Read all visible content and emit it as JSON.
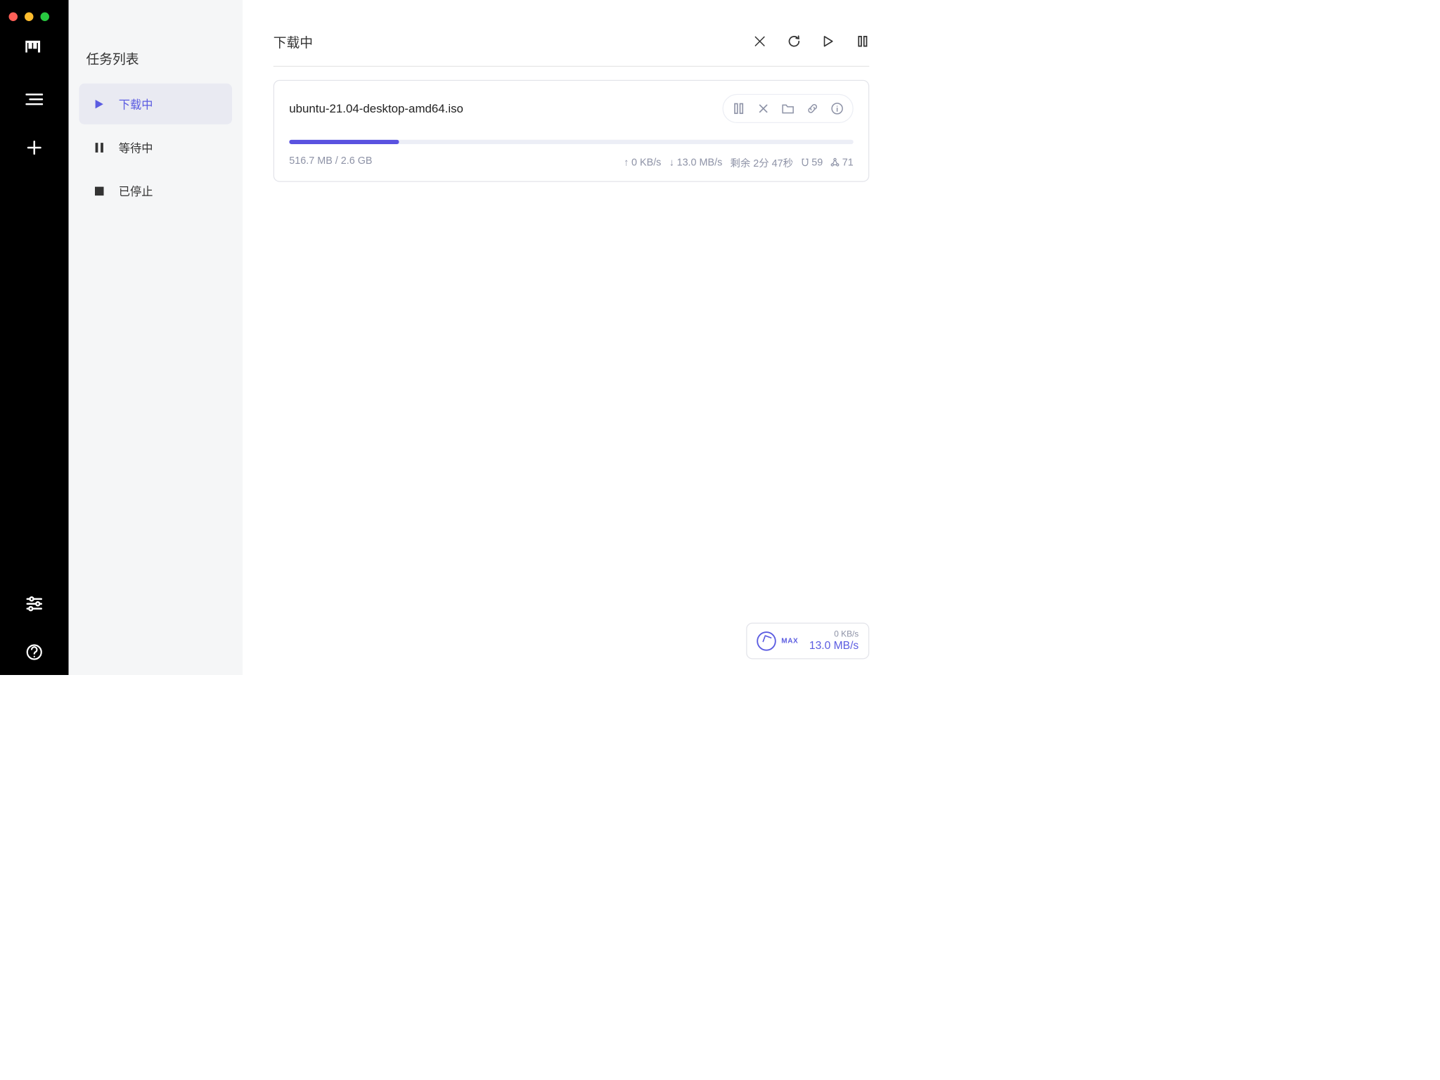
{
  "sidebar": {
    "title": "任务列表",
    "items": [
      {
        "label": "下载中",
        "icon": "play-icon",
        "active": true
      },
      {
        "label": "等待中",
        "icon": "pause-icon",
        "active": false
      },
      {
        "label": "已停止",
        "icon": "stop-icon",
        "active": false
      }
    ]
  },
  "main": {
    "title": "下载中"
  },
  "tasks": [
    {
      "name": "ubuntu-21.04-desktop-amd64.iso",
      "progress_pct": 19.5,
      "size_label": "516.7 MB / 2.6 GB",
      "up_speed": "0 KB/s",
      "down_speed": "13.0 MB/s",
      "remaining": "剩余 2分 47秒",
      "seeds": "59",
      "peers": "71"
    }
  ],
  "speed": {
    "max_label": "MAX",
    "up": "0 KB/s",
    "down": "13.0 MB/s"
  }
}
